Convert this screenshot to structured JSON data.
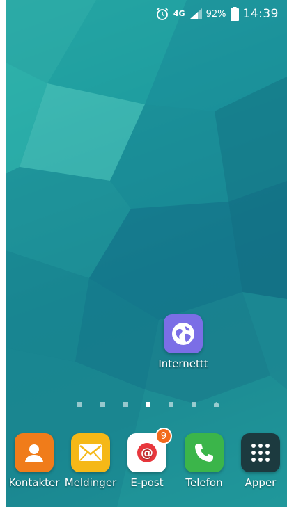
{
  "status_bar": {
    "network": "4G",
    "battery_percent": "92%",
    "time": "14:39"
  },
  "home": {
    "internet_label": "Internettt"
  },
  "page_indicator": {
    "pages": 7,
    "active": 4
  },
  "dock": {
    "items": [
      {
        "label": "Kontakter",
        "icon": "contacts-icon",
        "color": "#f07c1a"
      },
      {
        "label": "Meldinger",
        "icon": "messages-icon",
        "color": "#f5b817"
      },
      {
        "label": "E-post",
        "icon": "email-icon",
        "color": "#ffffff",
        "badge": "9"
      },
      {
        "label": "Telefon",
        "icon": "phone-icon",
        "color": "#3bb54a"
      },
      {
        "label": "Apper",
        "icon": "apps-grid-icon",
        "color": "#1c3a3f"
      }
    ]
  }
}
